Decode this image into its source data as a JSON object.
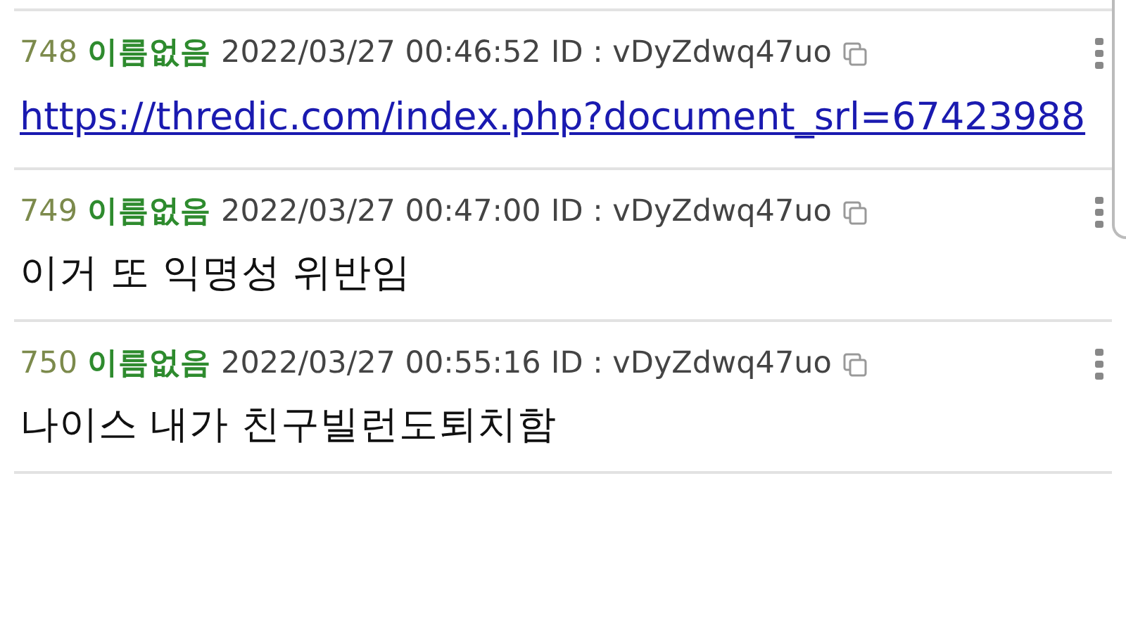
{
  "posts": [
    {
      "number": "748",
      "author": "이름없음",
      "date": "2022/03/27 00:46:52",
      "id_label": "ID : vDyZdwq47uo",
      "body": {
        "kind": "link",
        "text": "https://thredic.com/index.php?document_srl=67423988"
      }
    },
    {
      "number": "749",
      "author": "이름없음",
      "date": "2022/03/27 00:47:00",
      "id_label": "ID : vDyZdwq47uo",
      "body": {
        "kind": "text",
        "text": "이거 또 익명성 위반임"
      }
    },
    {
      "number": "750",
      "author": "이름없음",
      "date": "2022/03/27 00:55:16",
      "id_label": "ID : vDyZdwq47uo",
      "body": {
        "kind": "text",
        "text": "나이스 내가 친구빌런도퇴치함"
      }
    }
  ]
}
